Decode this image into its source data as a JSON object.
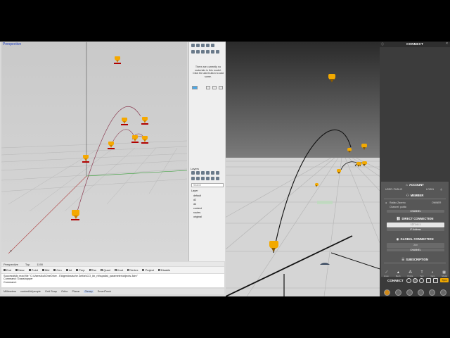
{
  "rhino": {
    "viewport_label": "Perspective",
    "props_panel": {
      "materials_message": "There are currently no materials in this model. Click the add button to add some."
    },
    "layers": {
      "title": "Layers",
      "search_placeholder": "Search",
      "column_header": "Layer",
      "items": [
        "default",
        "d2",
        "d4",
        "context",
        "routes",
        "original"
      ]
    },
    "command_tabs": [
      "Perspective",
      "Top",
      "1190"
    ],
    "osnap": {
      "tabs": [
        "Osnap",
        "Selection Filters"
      ],
      "items": [
        {
          "label": "End",
          "on": true
        },
        {
          "label": "Near",
          "on": true
        },
        {
          "label": "Point",
          "on": true
        },
        {
          "label": "Mid",
          "on": true
        },
        {
          "label": "Cen",
          "on": true
        },
        {
          "label": "Int",
          "on": true
        },
        {
          "label": "Perp",
          "on": true
        },
        {
          "label": "Tan",
          "on": false
        },
        {
          "label": "Quad",
          "on": false
        },
        {
          "label": "Knot",
          "on": false
        },
        {
          "label": "Vertex",
          "on": false
        },
        {
          "label": "Project",
          "on": false
        },
        {
          "label": "Disable",
          "on": false
        }
      ]
    },
    "command_history": [
      "Successfully read file \"C:\\Users\\kul\\OneDrive - Eidgenössische Zeit\\a\\ICO_kb_rib\\spatial_parameter\\objects.3dm\"",
      "Command: Grasshopper",
      "Command:"
    ],
    "statusbar": [
      "Millimeters",
      "context/ld/people",
      "Grid Snap",
      "Ortho",
      "Planar",
      "Osnap",
      "SmartTrack"
    ],
    "statusbar_active": "Osnap"
  },
  "viewer": {
    "connect_panel": {
      "title": "CONNECT",
      "account_title": "ACCOUNT",
      "account_labels": [
        "USER: PUBLIC",
        "LOGIN"
      ],
      "member_title": "MEMBER",
      "member_name": "Rafalo Zaverio",
      "member_role": "OWNER",
      "member_channel": "Channel: public",
      "channel_bar": "CHANNEL",
      "direct_title": "DIRECT CONNECTION",
      "direct_ip": "127.0.0.1",
      "direct_bar": "IP Address",
      "global_title": "GLOBAL CONNECTION",
      "global_field": "Join",
      "global_bar": "CHANNEL",
      "subscription_title": "SUBSCRIPTION",
      "subscription_labels": [
        "Lines",
        "Mesh",
        "Points",
        "Text",
        "Cam",
        "Model"
      ],
      "footer_label": "CONNECT",
      "footer_badge": "Sync"
    }
  },
  "colors": {
    "pin": "#f2a900",
    "panel_dark": "#3c3c3c",
    "panel_mid": "#575757",
    "accent": "#f0a800"
  }
}
